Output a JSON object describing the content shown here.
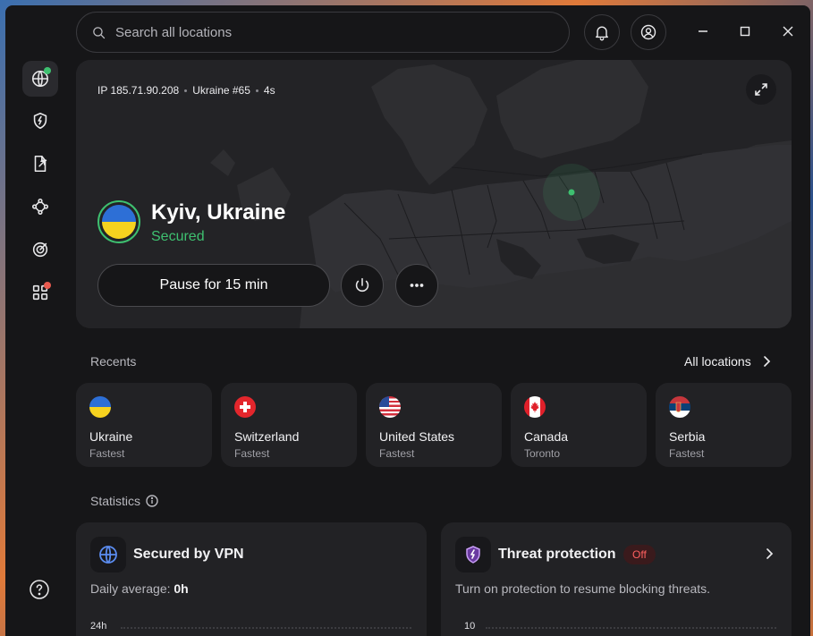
{
  "app": {
    "accent_green": "#3ec070",
    "badge_green": "#3ec070",
    "badge_red": "#e85a4f"
  },
  "sidebar": {
    "items": [
      {
        "name": "globe-icon",
        "active": true
      },
      {
        "name": "shield-bolt-icon"
      },
      {
        "name": "file-share-icon"
      },
      {
        "name": "mesh-network-icon"
      },
      {
        "name": "target-icon"
      },
      {
        "name": "apps-grid-icon"
      },
      {
        "name": "help-icon"
      }
    ]
  },
  "search": {
    "placeholder": "Search all locations"
  },
  "hero": {
    "ip": "IP 185.71.90.208",
    "server": "Ukraine #65",
    "uptime": "4s",
    "location": "Kyiv, Ukraine",
    "status": "Secured",
    "pause_label": "Pause for 15 min"
  },
  "recents": {
    "label": "Recents",
    "all_locations": "All locations",
    "items": [
      {
        "name": "Ukraine",
        "sub": "Fastest",
        "flag": "ukraine-flag-icon"
      },
      {
        "name": "Switzerland",
        "sub": "Fastest",
        "flag": "switzerland-flag-icon"
      },
      {
        "name": "United States",
        "sub": "Fastest",
        "flag": "united-states-flag-icon"
      },
      {
        "name": "Canada",
        "sub": "Toronto",
        "flag": "canada-flag-icon"
      },
      {
        "name": "Serbia",
        "sub": "Fastest",
        "flag": "serbia-flag-icon"
      }
    ]
  },
  "statistics": {
    "label": "Statistics",
    "vpn": {
      "title": "Secured by VPN",
      "daily_label": "Daily average:",
      "daily_value": "0h",
      "axis_top": "24h"
    },
    "threat": {
      "title": "Threat protection",
      "badge": "Off",
      "text": "Turn on protection to resume blocking threats.",
      "axis_top": "10"
    }
  }
}
